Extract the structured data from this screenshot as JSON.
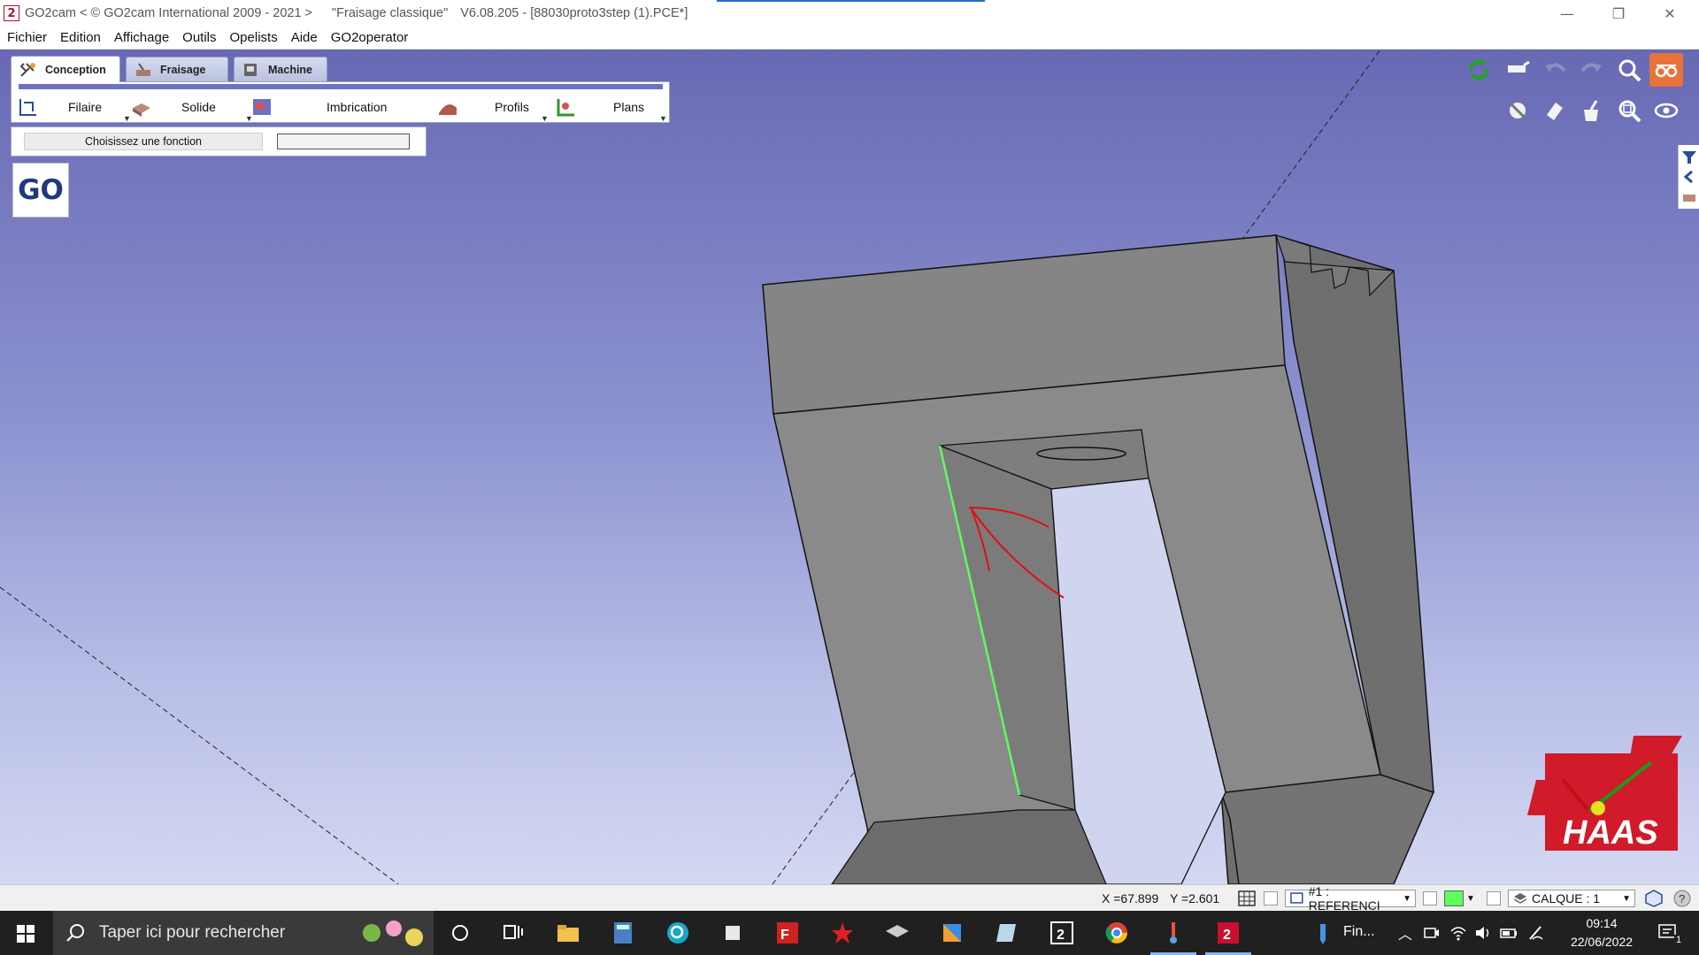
{
  "window": {
    "app_name": "GO2cam < © GO2cam International 2009 - 2021 >",
    "mode": "\"Fraisage classique\"",
    "version_file": "V6.08.205 - [88030proto3step (1).PCE*]",
    "controls": {
      "minimize": "—",
      "restore": "❐",
      "close": "✕"
    }
  },
  "menu": [
    "Fichier",
    "Edition",
    "Affichage",
    "Outils",
    "Opelists",
    "Aide",
    "GO2operator"
  ],
  "ribbon": {
    "tabs": [
      {
        "label": "Conception",
        "active": true
      },
      {
        "label": "Fraisage",
        "active": false
      },
      {
        "label": "Machine",
        "active": false
      }
    ],
    "buttons": [
      {
        "label": "Filaire",
        "icon": "wireframe-icon"
      },
      {
        "label": "Solide",
        "icon": "solid-icon"
      },
      {
        "label": "Imbrication",
        "icon": "nesting-icon"
      },
      {
        "label": "Profils",
        "icon": "profiles-icon"
      },
      {
        "label": "Plans",
        "icon": "planes-icon"
      }
    ]
  },
  "function_panel": {
    "prompt": "Choisissez une fonction",
    "input_value": ""
  },
  "go_button": "GO",
  "toolbar_icons": [
    "refresh-icon",
    "hand-pointer-icon",
    "undo-icon",
    "redo-icon",
    "zoom-icon",
    "glasses-icon",
    "hide-icon",
    "eraser-icon",
    "broom-icon",
    "zoom-window-icon",
    "eye-icon"
  ],
  "status": {
    "x_coord": "X =67.899",
    "y_coord": "Y =2.601",
    "reference": "#1 : REFERENCI",
    "layer": "CALQUE : 1",
    "accent_color": "#5cff5c"
  },
  "taskbar": {
    "search_placeholder": "Taper ici pour rechercher",
    "tray_text": "Fin...",
    "time": "09:14",
    "date": "22/06/2022",
    "notifications": "1"
  },
  "logo": {
    "text": "HAAS",
    "color": "#d11a2a"
  }
}
